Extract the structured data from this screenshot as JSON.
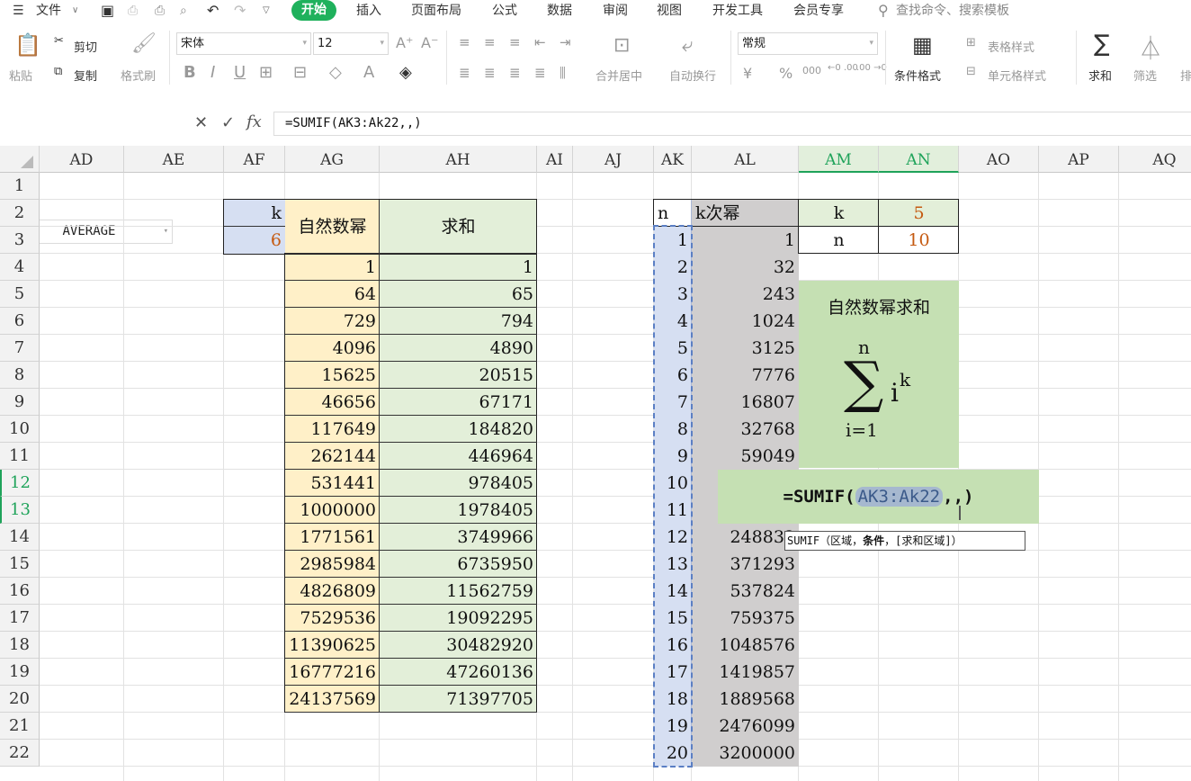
{
  "app": {
    "menu_label": "文件",
    "tabs": [
      "开始",
      "插入",
      "页面布局",
      "公式",
      "数据",
      "审阅",
      "视图",
      "开发工具",
      "会员专享"
    ],
    "active_tab": "开始",
    "search_placeholder": "查找命令、搜索模板"
  },
  "ribbon": {
    "paste": "粘贴",
    "cut": "剪切",
    "copy": "复制",
    "format_painter": "格式刷",
    "font_name": "宋体",
    "font_size": "12",
    "bold": "B",
    "italic": "I",
    "underline": "U",
    "merge_center": "合并居中",
    "wrap_text": "自动换行",
    "number_format": "常规",
    "currency": "¥",
    "percent": "%",
    "thousands": "000",
    "dec_inc": "←0 .00",
    "dec_dec": ".00 →0",
    "conditional_format": "条件格式",
    "table_style": "表格样式",
    "cell_style": "单元格样式",
    "sum": "求和",
    "filter": "筛选",
    "sort": "排"
  },
  "formula_bar": {
    "name_box": "AVERAGE",
    "cancel": "✕",
    "confirm": "✓",
    "fx": "fx",
    "formula": "=SUMIF(AK3:Ak22,,)"
  },
  "columns": [
    "AD",
    "AE",
    "AF",
    "AG",
    "AH",
    "AI",
    "AJ",
    "AK",
    "AL",
    "AM",
    "AN",
    "AO",
    "AP",
    "AQ"
  ],
  "rows": [
    "1",
    "2",
    "3",
    "4",
    "5",
    "6",
    "7",
    "8",
    "9",
    "10",
    "11",
    "12",
    "13",
    "14",
    "15",
    "16",
    "17",
    "18",
    "19",
    "20",
    "21",
    "22"
  ],
  "table1": {
    "k_label": "k",
    "k_value": "6",
    "header_power": "自然数幂",
    "header_sum": "求和",
    "powers": [
      "1",
      "64",
      "729",
      "4096",
      "15625",
      "46656",
      "117649",
      "262144",
      "531441",
      "1000000",
      "1771561",
      "2985984",
      "4826809",
      "7529536",
      "11390625",
      "16777216",
      "24137569"
    ],
    "sums": [
      "1",
      "65",
      "794",
      "4890",
      "20515",
      "67171",
      "184820",
      "446964",
      "978405",
      "1978405",
      "3749966",
      "6735950",
      "11562759",
      "19092295",
      "30482920",
      "47260136",
      "71397705"
    ]
  },
  "table2": {
    "header_n": "n",
    "header_kpow": "k次幂",
    "n_values": [
      "1",
      "2",
      "3",
      "4",
      "5",
      "6",
      "7",
      "8",
      "9",
      "10",
      "11",
      "12",
      "13",
      "14",
      "15",
      "16",
      "17",
      "18",
      "19",
      "20"
    ],
    "kpow_values": [
      "1",
      "32",
      "243",
      "1024",
      "3125",
      "7776",
      "16807",
      "32768",
      "59049",
      "",
      "",
      "248832",
      "371293",
      "537824",
      "759375",
      "1048576",
      "1419857",
      "1889568",
      "2476099",
      "3200000"
    ]
  },
  "params": {
    "k_label": "k",
    "k_value": "5",
    "n_label": "n",
    "n_value": "10"
  },
  "formula_box": {
    "title": "自然数幂求和",
    "sigma": "∑",
    "upper": "n",
    "lower": "i=1",
    "term": "i",
    "exponent": "k"
  },
  "editor": {
    "prefix": "=SUMIF(",
    "ref": "AK3:Ak22",
    "suffix": ",,)"
  },
  "tooltip": {
    "fn": "SUMIF",
    "open": "（",
    "arg1": "区域，",
    "arg2": "条件",
    "arg3": "，[求和区域]）"
  },
  "colors": {
    "accent": "#1fb15c",
    "blue_cell": "#d6dff2",
    "yellow_cell": "#fff0c8",
    "green_cell": "#e3efd9",
    "gray_cell": "#d0cece",
    "formula_green": "#c5e0b3",
    "param_orange": "#c55a11"
  }
}
